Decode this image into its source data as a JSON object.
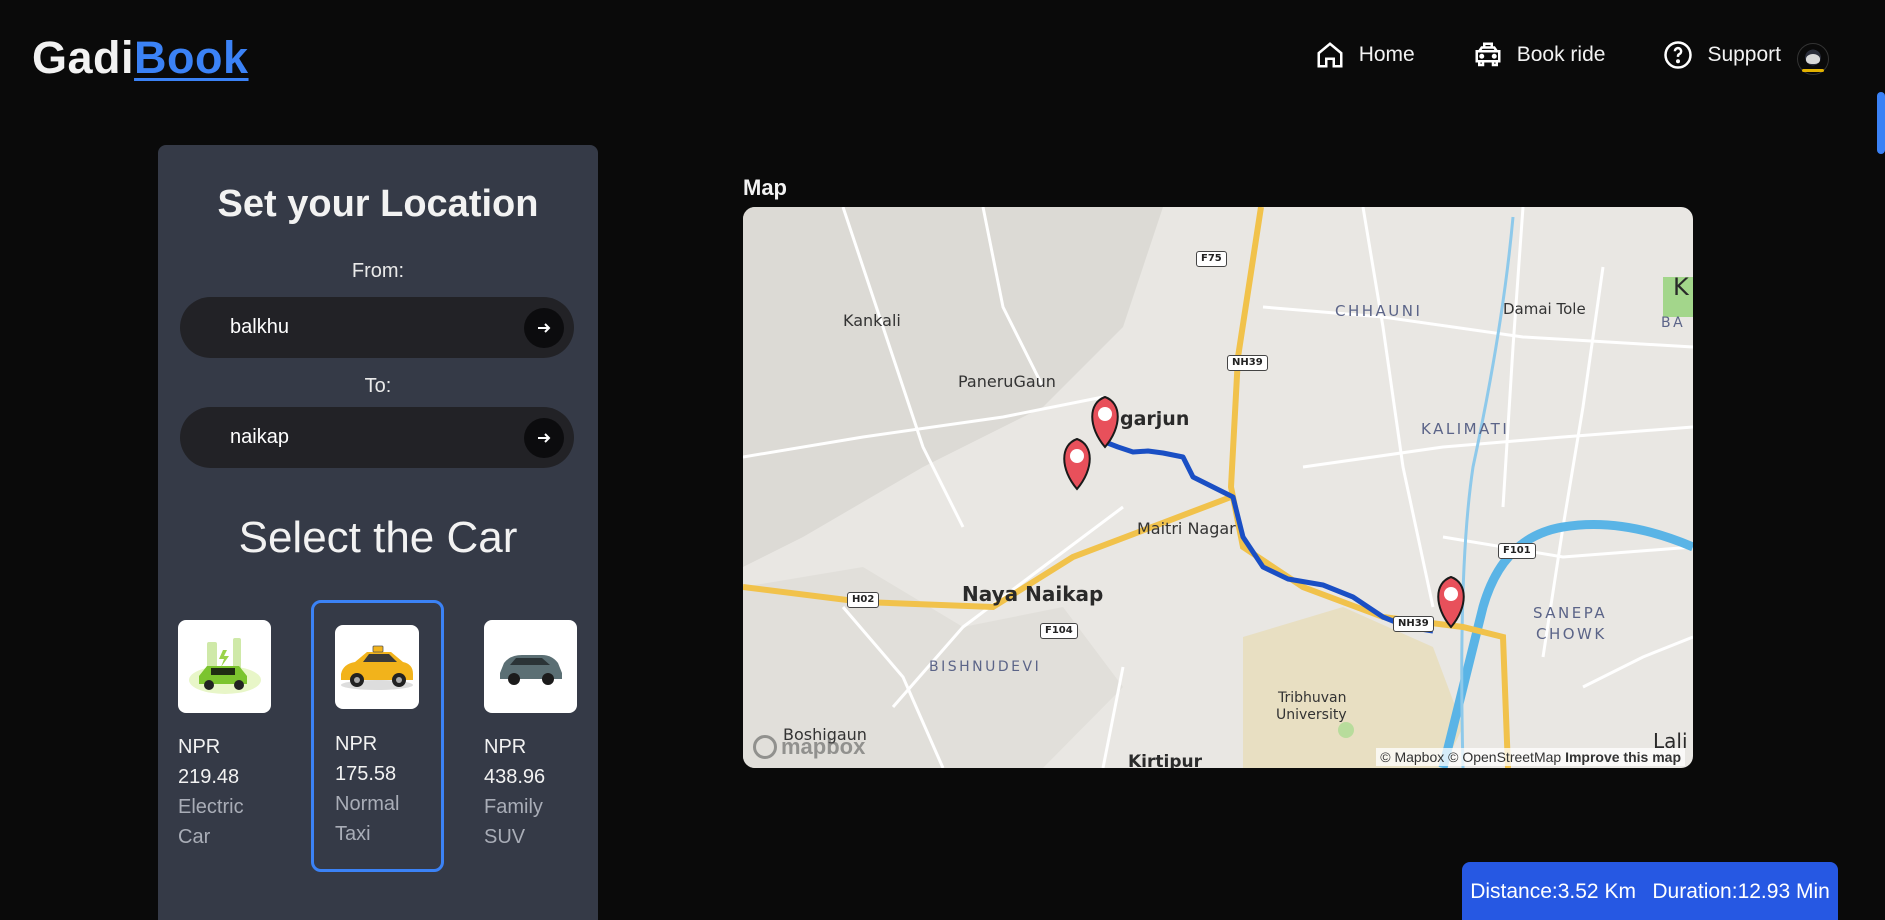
{
  "app": {
    "logo_part1": "Gadi",
    "logo_part2": "Book"
  },
  "nav": [
    {
      "label": "Home",
      "icon": "home-icon"
    },
    {
      "label": "Book ride",
      "icon": "car-front-icon"
    },
    {
      "label": "Support",
      "icon": "help-circle-icon"
    }
  ],
  "panel": {
    "title": "Set your Location",
    "from_label": "From:",
    "from_value": "balkhu",
    "to_label": "To:",
    "to_value": "naikap",
    "car_section_title": "Select the Car"
  },
  "cars": [
    {
      "price": "NPR\n219.48",
      "name": "Electric\nCar",
      "selected": false
    },
    {
      "price": "NPR\n175.58",
      "name": "Normal\nTaxi",
      "selected": true
    },
    {
      "price": "NPR\n438.96",
      "name": "Family\nSUV",
      "selected": false
    }
  ],
  "map": {
    "title": "Map",
    "labels": {
      "kankali": "Kankali",
      "chhauni": "CHHAUNI",
      "damai_tole": "Damai Tole",
      "paneru_gaun": "PaneruGaun",
      "nagarjun": "garjun",
      "kalimati": "KALIMATI",
      "maitri_nagar": "Maitri Nagar",
      "naya_naikap": "Naya Naikap",
      "bishnudevi": "BISHNUDEVI",
      "sanepa": "SANEPA",
      "chowk": "CHOWK",
      "tribhuvan": "Tribhuvan",
      "university": "University",
      "boshigaun": "Boshigaun",
      "kirtipur": "Kirtipur",
      "lali": "Lali",
      "k_edge": "K",
      "ba_edge": "BA"
    },
    "shields": {
      "f75": "F75",
      "nh39": "NH39",
      "f101": "F101",
      "h02": "H02",
      "f104": "F104",
      "nh39b": "NH39"
    },
    "attribution_1": "© Mapbox © OpenStreetMap",
    "attribution_2": "Improve this map",
    "logo": "mapbox",
    "colors": {
      "route": "#1a4fc4",
      "highway": "#f1c24b",
      "pin": "#e8505b",
      "river": "#5ab4e6"
    }
  },
  "trip": {
    "distance": "Distance:3.52 Km",
    "duration": "Duration:12.93 Min"
  }
}
